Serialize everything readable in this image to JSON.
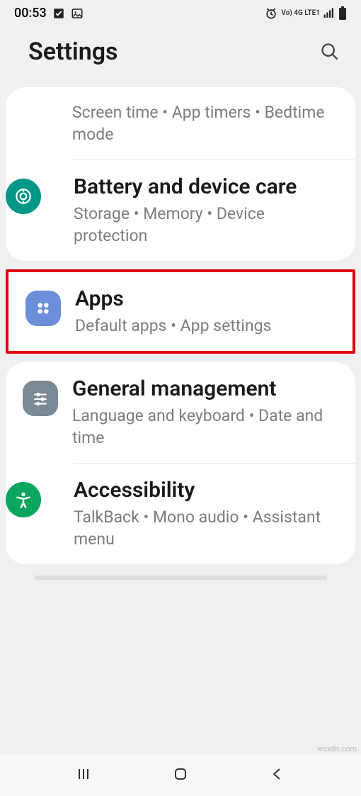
{
  "status": {
    "time": "00:53",
    "network_label": "Vo) 4G LTE1"
  },
  "header": {
    "title": "Settings"
  },
  "partial_row": {
    "sub": "Screen time  •  App timers  •  Bedtime mode"
  },
  "battery": {
    "title": "Battery and device care",
    "sub": "Storage  •  Memory  •  Device protection"
  },
  "apps": {
    "title": "Apps",
    "sub": "Default apps  •  App settings"
  },
  "general": {
    "title": "General management",
    "sub": "Language and keyboard  •  Date and time"
  },
  "accessibility": {
    "title": "Accessibility",
    "sub": "TalkBack  •  Mono audio  •  Assistant menu"
  },
  "watermark": "wsxdn.com"
}
